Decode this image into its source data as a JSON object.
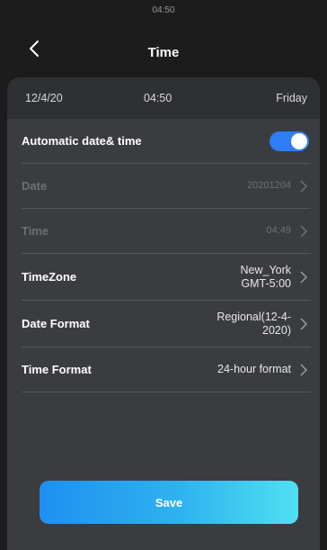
{
  "status_bar": {
    "time": "04:50"
  },
  "header": {
    "title": "Time"
  },
  "info_bar": {
    "date": "12/4/20",
    "time": "04:50",
    "weekday": "Friday"
  },
  "settings": {
    "auto": {
      "label": "Automatic date& time",
      "enabled": true
    },
    "date": {
      "label": "Date",
      "value": "20201204"
    },
    "time": {
      "label": "Time",
      "value": "04:49"
    },
    "timezone": {
      "label": "TimeZone",
      "value_line1": "New_York",
      "value_line2": "GMT-5:00"
    },
    "date_format": {
      "label": "Date Format",
      "value_line1": "Regional(12-4-",
      "value_line2": "2020)"
    },
    "time_format": {
      "label": "Time Format",
      "value": "24-hour format"
    }
  },
  "save": {
    "label": "Save"
  },
  "colors": {
    "accent": "#2e7df6",
    "panel": "#3a3c40",
    "background": "#1c1c1c"
  }
}
